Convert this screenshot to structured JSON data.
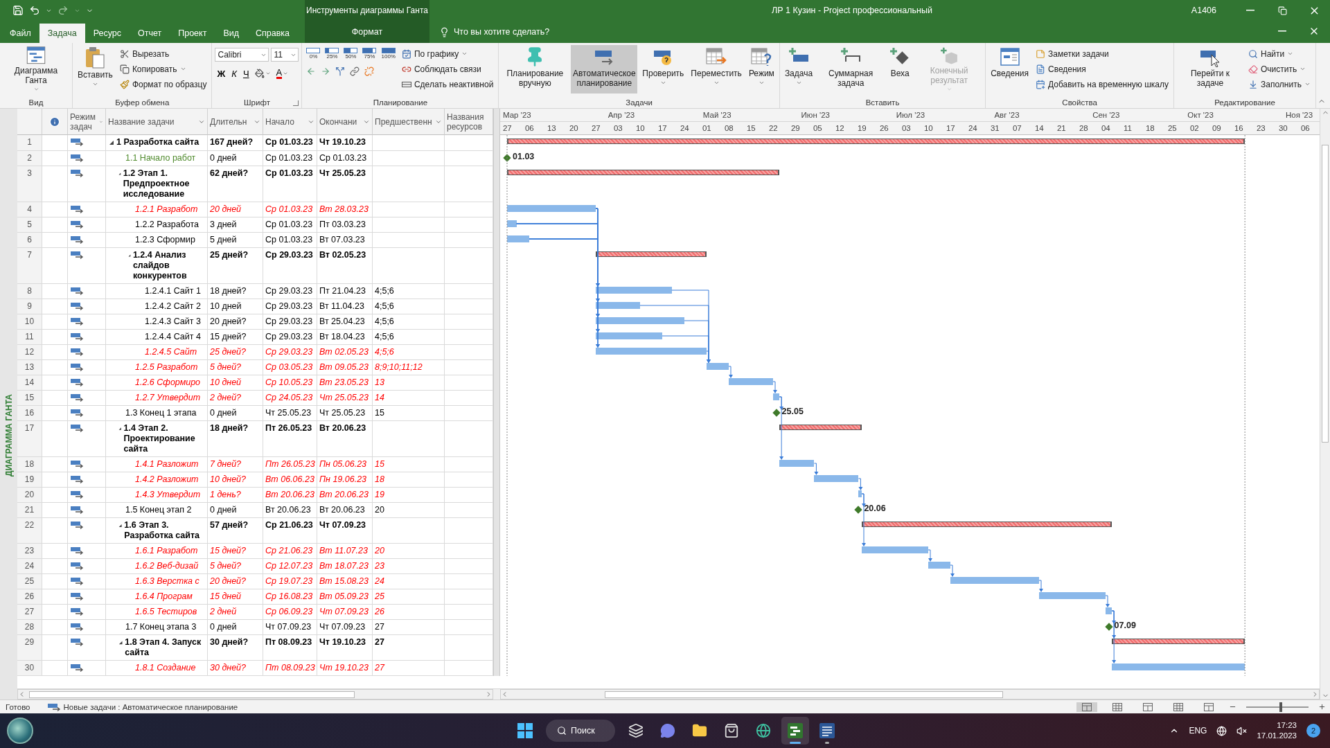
{
  "window": {
    "title": "ЛР 1 Кузин  -  Project профессиональный",
    "user": "A1406",
    "context_header": "Инструменты диаграммы Ганта"
  },
  "tabs": [
    {
      "label": "Файл",
      "selected": false,
      "kind": "tab"
    },
    {
      "label": "Задача",
      "selected": true,
      "kind": "tab"
    },
    {
      "label": "Ресурс",
      "selected": false,
      "kind": "tab"
    },
    {
      "label": "Отчет",
      "selected": false,
      "kind": "tab"
    },
    {
      "label": "Проект",
      "selected": false,
      "kind": "tab"
    },
    {
      "label": "Вид",
      "selected": false,
      "kind": "tab"
    },
    {
      "label": "Справка",
      "selected": false,
      "kind": "tab"
    },
    {
      "label": "Формат",
      "selected": false,
      "kind": "context"
    }
  ],
  "tell_me": {
    "placeholder": "Что вы хотите сделать?"
  },
  "ribbon": {
    "groups": [
      {
        "label": "Вид",
        "items": [
          {
            "kind": "large",
            "label": "Диаграмма Ганта",
            "dropdown": true
          }
        ]
      },
      {
        "label": "Буфер обмена",
        "items": [
          {
            "kind": "large",
            "label": "Вставить",
            "dropdown": true
          },
          {
            "kind": "small",
            "label": "Вырезать",
            "dropdown": false
          },
          {
            "kind": "small",
            "label": "Копировать",
            "dropdown": true
          },
          {
            "kind": "small",
            "label": "Формат по образцу",
            "dropdown": false
          }
        ]
      },
      {
        "label": "Шрифт",
        "launcher": true,
        "items": [
          {
            "kind": "toolrow",
            "items": [
              {
                "kind": "combo",
                "value": "Calibri"
              },
              {
                "kind": "combo",
                "value": "11"
              }
            ]
          },
          {
            "kind": "toolrow",
            "items": [
              {
                "kind": "glyph",
                "label": "Ж",
                "dropdown": false
              },
              {
                "kind": "glyph",
                "label": "К",
                "dropdown": false
              },
              {
                "kind": "glyph",
                "label": "Ч",
                "dropdown": false
              },
              {
                "kind": "tool",
                "dropdown": true
              },
              {
                "kind": "glyph",
                "label": "А",
                "dropdown": true
              }
            ]
          }
        ]
      },
      {
        "label": "Планирование",
        "launcher": false,
        "items": [
          {
            "kind": "toolrow",
            "items": [
              {
                "kind": "percent",
                "label": "0%"
              },
              {
                "kind": "percent",
                "label": "25%",
                "level": 0.25
              },
              {
                "kind": "percent",
                "label": "50%",
                "level": 0.5
              },
              {
                "kind": "percent",
                "label": "75%",
                "level": 0.75
              },
              {
                "kind": "percent",
                "label": "100%",
                "level": 1
              }
            ]
          },
          {
            "kind": "toolrow",
            "items": [
              {
                "kind": "tool",
                "dropdown": false
              },
              {
                "kind": "tool",
                "dropdown": false
              },
              {
                "kind": "tool",
                "dropdown": false
              },
              {
                "kind": "tool",
                "dropdown": false
              },
              {
                "kind": "tool",
                "dropdown": false
              }
            ]
          },
          {
            "kind": "small",
            "label": "По графику",
            "dropdown": true
          },
          {
            "kind": "small",
            "label": "Соблюдать связи",
            "dropdown": false
          },
          {
            "kind": "small",
            "label": "Сделать неактивной",
            "dropdown": false
          }
        ]
      },
      {
        "label": "Задачи",
        "items": [
          {
            "kind": "large",
            "label": "Планирование вручную",
            "dropdown": false,
            "selected": false
          },
          {
            "kind": "large",
            "label": "Автоматическое планирование",
            "dropdown": false,
            "selected": true
          },
          {
            "kind": "large",
            "label": "Проверить",
            "dropdown": true,
            "selected": false
          },
          {
            "kind": "large",
            "label": "Переместить",
            "dropdown": true,
            "selected": false
          },
          {
            "kind": "large",
            "label": "Режим",
            "dropdown": true,
            "selected": false
          }
        ]
      },
      {
        "label": "Вставить",
        "items": [
          {
            "kind": "large",
            "label": "Задача",
            "dropdown": true,
            "disabled": false
          },
          {
            "kind": "large",
            "label": "Суммарная задача",
            "dropdown": false,
            "disabled": false
          },
          {
            "kind": "large",
            "label": "Веха",
            "dropdown": false,
            "disabled": false
          },
          {
            "kind": "large",
            "label": "Конечный результат",
            "dropdown": true,
            "disabled": true
          }
        ]
      },
      {
        "label": "Свойства",
        "items": [
          {
            "kind": "large",
            "label": "Сведения",
            "dropdown": false
          },
          {
            "kind": "small",
            "label": "Заметки задачи",
            "dropdown": false
          },
          {
            "kind": "small",
            "label": "Сведения",
            "dropdown": false
          },
          {
            "kind": "small",
            "label": "Добавить на временную шкалу",
            "dropdown": false
          }
        ]
      },
      {
        "label": "Редактирование",
        "items": [
          {
            "kind": "large",
            "label": "Перейти к задаче",
            "dropdown": false
          },
          {
            "kind": "small",
            "label": "Найти",
            "dropdown": true
          },
          {
            "kind": "small",
            "label": "Очистить",
            "dropdown": true
          },
          {
            "kind": "small",
            "label": "Заполнить",
            "dropdown": true
          }
        ]
      }
    ]
  },
  "side_label": "ДИАГРАММА ГАНТА",
  "table": {
    "columns": [
      {
        "label": "Режим задач",
        "filter": true
      },
      {
        "label": "Название задачи",
        "filter": true
      },
      {
        "label": "Длительн",
        "filter": true
      },
      {
        "label": "Начало",
        "filter": true
      },
      {
        "label": "Окончани",
        "filter": true
      },
      {
        "label": "Предшественн",
        "filter": true
      },
      {
        "label": "Названия ресурсов",
        "filter": false
      }
    ],
    "tasks": [
      {
        "num": "1",
        "name": "1 Разработка сайта",
        "duration": "167 дней?",
        "start": "Ср 01.03.23",
        "finish": "Чт 19.10.23",
        "kind": "summary",
        "critical": false,
        "expanded": true,
        "children": [
          {
            "num": "2",
            "name": "1.1 Начало работ",
            "duration": "0 дней",
            "start": "Ср 01.03.23",
            "finish": "Ср 01.03.23",
            "kind": "milestone",
            "critical": false,
            "color": "#4f8a2c",
            "bar_label": "01.03"
          },
          {
            "num": "3",
            "name": "1.2 Этап 1. Предпроектное исследование",
            "duration": "62 дней?",
            "start": "Ср 01.03.23",
            "finish": "Чт 25.05.23",
            "kind": "summary",
            "critical": false,
            "expanded": true,
            "children": [
              {
                "num": "4",
                "name": "1.2.1 Разработ",
                "duration": "20 дней",
                "start": "Ср 01.03.23",
                "finish": "Вт 28.03.23",
                "kind": "task",
                "critical": true
              },
              {
                "num": "5",
                "name": "1.2.2 Разработа",
                "duration": "3 дней",
                "start": "Ср 01.03.23",
                "finish": "Пт 03.03.23",
                "kind": "task",
                "critical": false
              },
              {
                "num": "6",
                "name": "1.2.3 Сформир",
                "duration": "5 дней",
                "start": "Ср 01.03.23",
                "finish": "Вт 07.03.23",
                "kind": "task",
                "critical": false
              },
              {
                "num": "7",
                "name": "1.2.4 Анализ слайдов конкурентов",
                "duration": "25 дней?",
                "start": "Ср 29.03.23",
                "finish": "Вт 02.05.23",
                "kind": "summary",
                "critical": false,
                "expanded": true,
                "children": [
                  {
                    "num": "8",
                    "name": "1.2.4.1 Сайт 1",
                    "duration": "18 дней?",
                    "start": "Ср 29.03.23",
                    "finish": "Пт 21.04.23",
                    "pred": "4;5;6",
                    "kind": "task",
                    "critical": false
                  },
                  {
                    "num": "9",
                    "name": "1.2.4.2 Сайт 2",
                    "duration": "10 дней",
                    "start": "Ср 29.03.23",
                    "finish": "Вт 11.04.23",
                    "pred": "4;5;6",
                    "kind": "task",
                    "critical": false
                  },
                  {
                    "num": "10",
                    "name": "1.2.4.3 Сайт 3",
                    "duration": "20 дней?",
                    "start": "Ср 29.03.23",
                    "finish": "Вт 25.04.23",
                    "pred": "4;5;6",
                    "kind": "task",
                    "critical": false
                  },
                  {
                    "num": "11",
                    "name": "1.2.4.4 Сайт 4",
                    "duration": "15 дней?",
                    "start": "Ср 29.03.23",
                    "finish": "Вт 18.04.23",
                    "pred": "4;5;6",
                    "kind": "task",
                    "critical": false
                  },
                  {
                    "num": "12",
                    "name": "1.2.4.5 Сайт",
                    "duration": "25 дней?",
                    "start": "Ср 29.03.23",
                    "finish": "Вт 02.05.23",
                    "pred": "4;5;6",
                    "kind": "task",
                    "critical": true
                  }
                ]
              },
              {
                "num": "13",
                "name": "1.2.5 Разработ",
                "duration": "5 дней?",
                "start": "Ср 03.05.23",
                "finish": "Вт 09.05.23",
                "pred": "8;9;10;11;12",
                "kind": "task",
                "critical": true
              },
              {
                "num": "14",
                "name": "1.2.6 Сформиро",
                "duration": "10 дней",
                "start": "Ср 10.05.23",
                "finish": "Вт 23.05.23",
                "pred": "13",
                "kind": "task",
                "critical": true
              },
              {
                "num": "15",
                "name": "1.2.7 Утвердит",
                "duration": "2 дней?",
                "start": "Ср 24.05.23",
                "finish": "Чт 25.05.23",
                "pred": "14",
                "kind": "task",
                "critical": true
              }
            ]
          },
          {
            "num": "16",
            "name": "1.3 Конец 1 этапа",
            "duration": "0 дней",
            "start": "Чт 25.05.23",
            "finish": "Чт 25.05.23",
            "pred": "15",
            "kind": "milestone",
            "critical": false,
            "bar_label": "25.05"
          },
          {
            "num": "17",
            "name": "1.4 Этап 2. Проектирование сайта",
            "duration": "18 дней?",
            "start": "Пт 26.05.23",
            "finish": "Вт 20.06.23",
            "kind": "summary",
            "critical": false,
            "expanded": true,
            "children": [
              {
                "num": "18",
                "name": "1.4.1 Разложит",
                "duration": "7 дней?",
                "start": "Пт 26.05.23",
                "finish": "Пн 05.06.23",
                "pred": "15",
                "kind": "task",
                "critical": true
              },
              {
                "num": "19",
                "name": "1.4.2 Разложит",
                "duration": "10 дней?",
                "start": "Вт 06.06.23",
                "finish": "Пн 19.06.23",
                "pred": "18",
                "kind": "task",
                "critical": true
              },
              {
                "num": "20",
                "name": "1.4.3 Утвердит",
                "duration": "1 день?",
                "start": "Вт 20.06.23",
                "finish": "Вт 20.06.23",
                "pred": "19",
                "kind": "task",
                "critical": true
              }
            ]
          },
          {
            "num": "21",
            "name": "1.5 Конец этап 2",
            "duration": "0 дней",
            "start": "Вт 20.06.23",
            "finish": "Вт 20.06.23",
            "pred": "20",
            "kind": "milestone",
            "critical": false,
            "bar_label": "20.06"
          },
          {
            "num": "22",
            "name": "1.6 Этап 3. Разработка сайта",
            "duration": "57 дней?",
            "start": "Ср 21.06.23",
            "finish": "Чт 07.09.23",
            "kind": "summary",
            "critical": false,
            "expanded": true,
            "children": [
              {
                "num": "23",
                "name": "1.6.1 Разработ",
                "duration": "15 дней?",
                "start": "Ср 21.06.23",
                "finish": "Вт 11.07.23",
                "pred": "20",
                "kind": "task",
                "critical": true
              },
              {
                "num": "24",
                "name": "1.6.2 Веб-дизай",
                "duration": "5 дней?",
                "start": "Ср 12.07.23",
                "finish": "Вт 18.07.23",
                "pred": "23",
                "kind": "task",
                "critical": true
              },
              {
                "num": "25",
                "name": "1.6.3 Верстка с",
                "duration": "20 дней?",
                "start": "Ср 19.07.23",
                "finish": "Вт 15.08.23",
                "pred": "24",
                "kind": "task",
                "critical": true
              },
              {
                "num": "26",
                "name": "1.6.4 Програм",
                "duration": "15 дней",
                "start": "Ср 16.08.23",
                "finish": "Вт 05.09.23",
                "pred": "25",
                "kind": "task",
                "critical": true
              },
              {
                "num": "27",
                "name": "1.6.5 Тестиров",
                "duration": "2 дней",
                "start": "Ср 06.09.23",
                "finish": "Чт 07.09.23",
                "pred": "26",
                "kind": "task",
                "critical": true
              }
            ]
          },
          {
            "num": "28",
            "name": "1.7 Конец этапа 3",
            "duration": "0 дней",
            "start": "Чт 07.09.23",
            "finish": "Чт 07.09.23",
            "pred": "27",
            "kind": "milestone",
            "critical": false,
            "bar_label": "07.09"
          },
          {
            "num": "29",
            "name": "1.8 Этап 4. Запуск сайта",
            "duration": "30 дней?",
            "start": "Пт 08.09.23",
            "finish": "Чт 19.10.23",
            "pred": "27",
            "kind": "summary",
            "critical": false,
            "expanded": true,
            "children": [
              {
                "num": "30",
                "name": "1.8.1 Создание",
                "duration": "30 дней?",
                "start": "Пт 08.09.23",
                "finish": "Чт 19.10.23",
                "pred": "27",
                "kind": "task",
                "critical": true
              }
            ]
          }
        ]
      }
    ]
  },
  "timeline": {
    "months": [
      "Мар '23",
      "Апр '23",
      "Май '23",
      "Июн '23",
      "Июл '23",
      "Авг '23",
      "Сен '23",
      "Окт '23",
      "Ноя '23"
    ],
    "weeks": [
      "27",
      "06",
      "13",
      "20",
      "27",
      "03",
      "10",
      "17",
      "24",
      "01",
      "08",
      "15",
      "22",
      "29",
      "05",
      "12",
      "19",
      "26",
      "03",
      "10",
      "17",
      "24",
      "31",
      "07",
      "14",
      "21",
      "28",
      "04",
      "11",
      "18",
      "25",
      "02",
      "09",
      "16",
      "23",
      "30",
      "06"
    ]
  },
  "status_bar": {
    "ready": "Готово",
    "mode": "Новые задачи : Автоматическое планирование",
    "zoom": {
      "level": 0.55
    }
  },
  "taskbar": {
    "search": "Поиск",
    "apps": [
      {
        "active": false,
        "running": false
      },
      {
        "active": false,
        "running": false
      },
      {
        "active": false,
        "running": false
      },
      {
        "active": false,
        "running": false
      },
      {
        "active": false,
        "running": false
      },
      {
        "active": true,
        "running": true
      },
      {
        "active": false,
        "running": true
      }
    ],
    "language": "ENG",
    "time": "17:23",
    "date": "17.01.2023",
    "notifications": "2"
  }
}
